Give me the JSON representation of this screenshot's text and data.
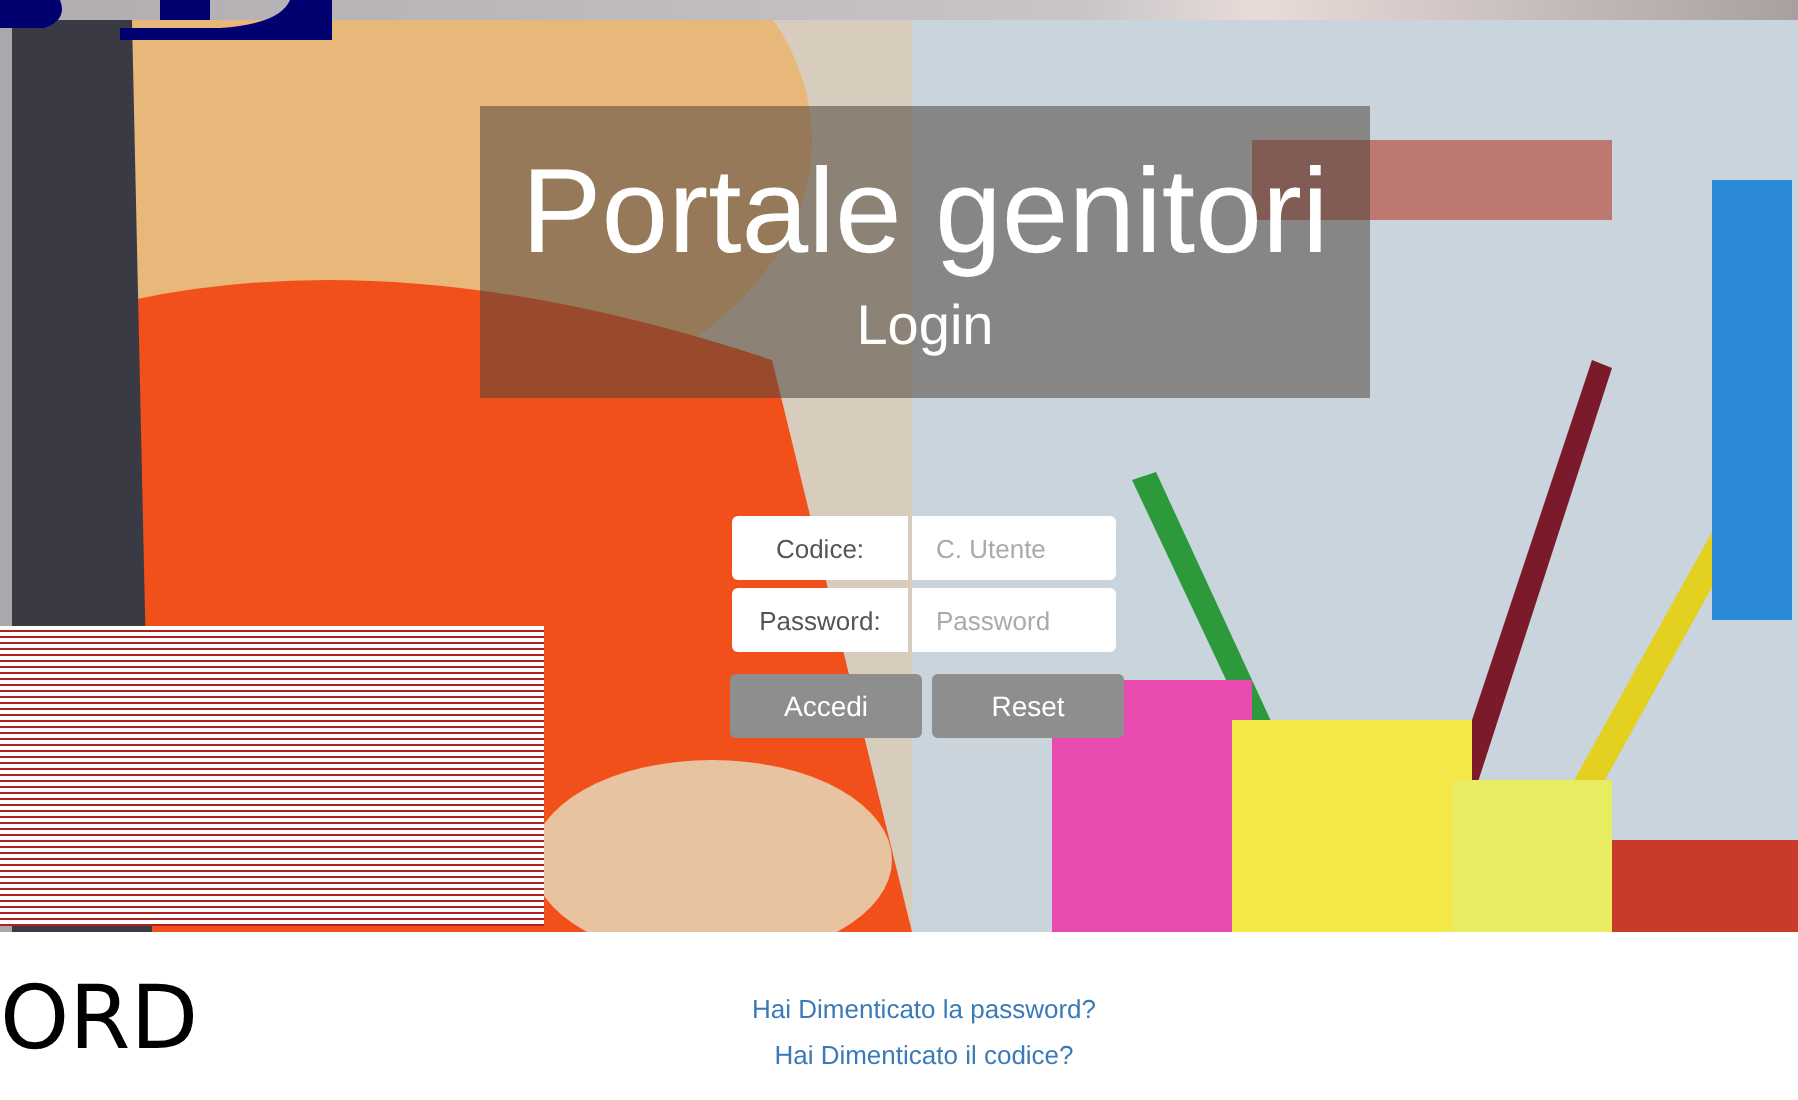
{
  "hero": {
    "title": "Portale genitori",
    "subtitle": "Login"
  },
  "form": {
    "fields": [
      {
        "label": "Codice:",
        "placeholder": "C. Utente"
      },
      {
        "label": "Password:",
        "placeholder": "Password"
      }
    ],
    "buttons": [
      "Accedi",
      "Reset"
    ]
  },
  "side_text": "ORD",
  "links": [
    "Hai Dimenticato la password?",
    "Hai Dimenticato il codice?"
  ]
}
